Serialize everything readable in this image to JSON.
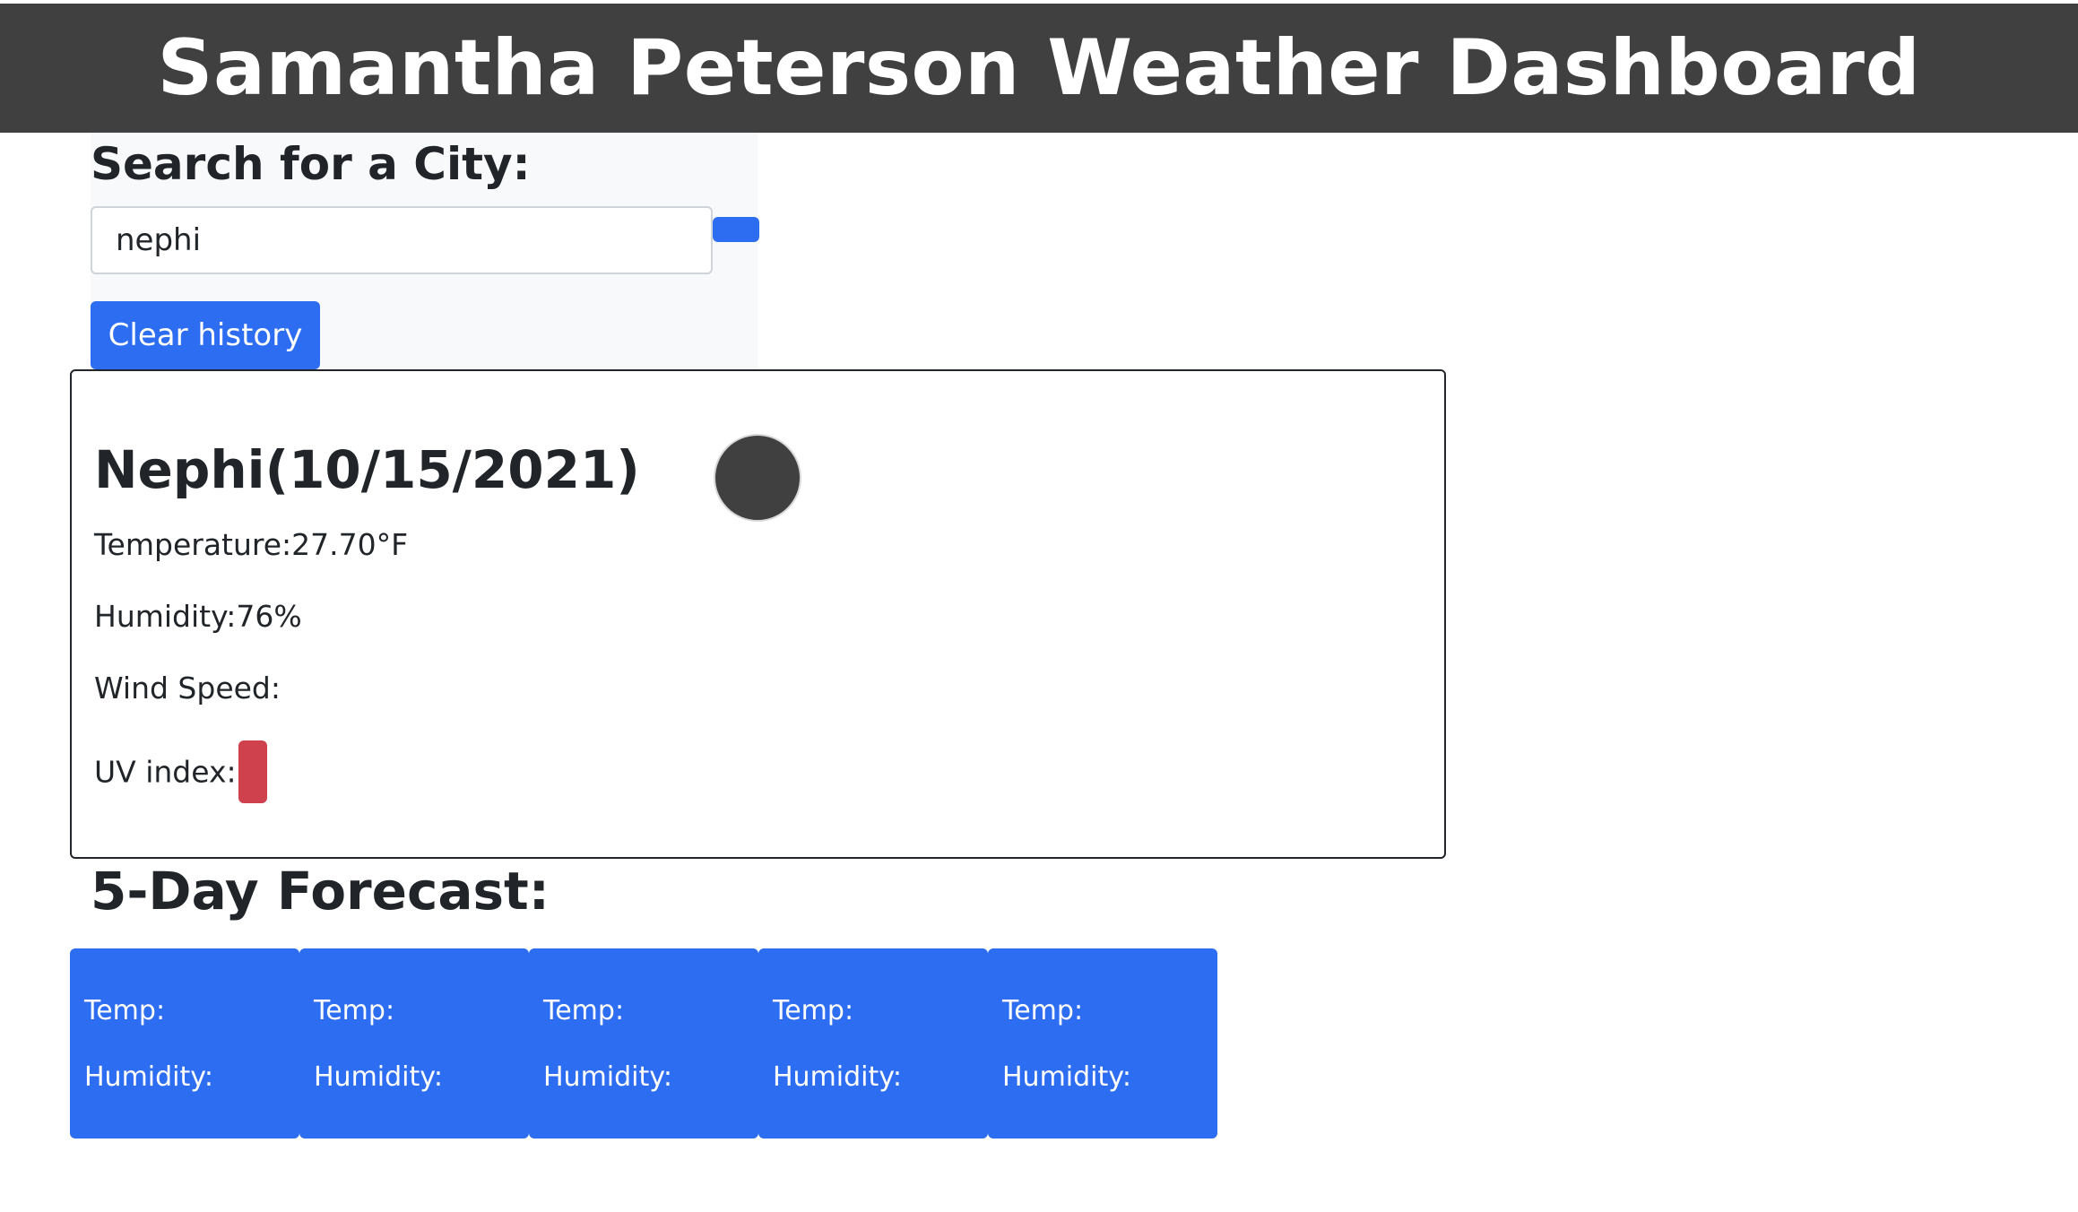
{
  "header": {
    "title": "Samantha Peterson Weather Dashboard"
  },
  "search": {
    "title": "Search for a City:",
    "input_value": "nephi",
    "clear_label": "Clear history"
  },
  "current": {
    "city_date": "Nephi(10/15/2021)",
    "temperature": "Temperature:27.70°F",
    "humidity": "Humidity:76%",
    "wind_speed": "Wind Speed:",
    "uv_index": "UV index:"
  },
  "forecast": {
    "title": "5-Day Forecast:",
    "cards": [
      {
        "temp": "Temp:",
        "humidity": "Humidity:"
      },
      {
        "temp": "Temp:",
        "humidity": "Humidity:"
      },
      {
        "temp": "Temp:",
        "humidity": "Humidity:"
      },
      {
        "temp": "Temp:",
        "humidity": "Humidity:"
      },
      {
        "temp": "Temp:",
        "humidity": "Humidity:"
      }
    ]
  },
  "colors": {
    "header_bg": "#404040",
    "primary": "#2c6df1",
    "uv_badge": "#d0414e"
  }
}
